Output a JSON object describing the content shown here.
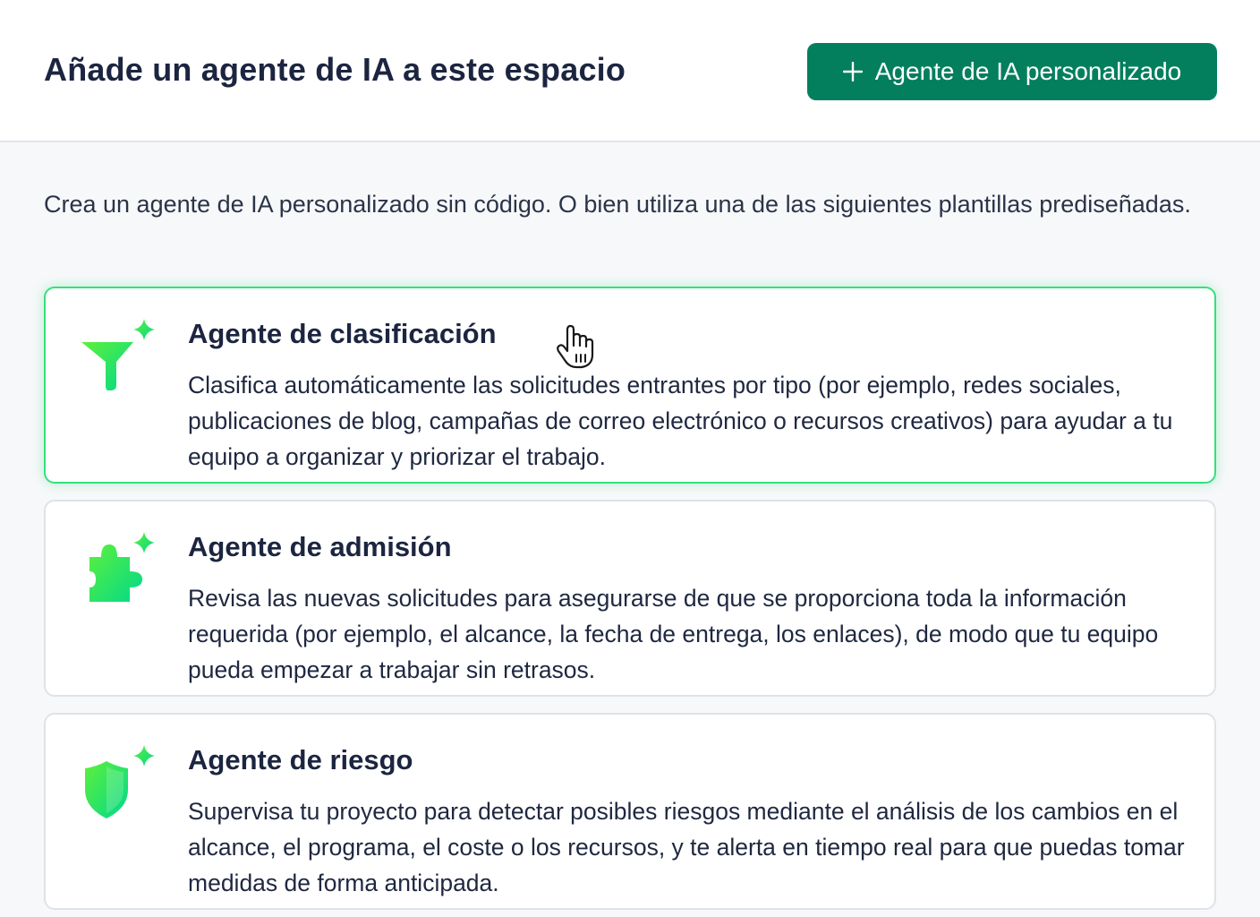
{
  "header": {
    "title": "Añade un agente de IA a este espacio",
    "add_button_label": "Agente de IA personalizado",
    "add_button_icon": "plus-icon"
  },
  "intro_text": "Crea un agente de IA personalizado sin código. O bien utiliza una de las siguientes plantillas prediseñadas.",
  "cards": [
    {
      "title": "Agente de clasificación",
      "description": "Clasifica automáticamente las solicitudes entrantes por tipo (por ejemplo, redes sociales, publicaciones de blog, campañas de correo electrónico o recursos creativos) para ayudar a tu equipo a organizar y priorizar el trabajo.",
      "icon": "funnel-sparkle-icon",
      "hovered": true
    },
    {
      "title": "Agente de admisión",
      "description": "Revisa las nuevas solicitudes para asegurarse de que se proporciona toda la información requerida (por ejemplo, el alcance, la fecha de entrega, los enlaces), de modo que tu equipo pueda empezar a trabajar sin retrasos.",
      "icon": "puzzle-sparkle-icon",
      "hovered": false
    },
    {
      "title": "Agente de riesgo",
      "description": "Supervisa tu proyecto para detectar posibles riesgos mediante el análisis de los cambios en el alcance, el programa, el coste o los recursos, y te alerta en tiempo real para que puedas tomar medidas de forma anticipada.",
      "icon": "shield-sparkle-icon",
      "hovered": false
    }
  ],
  "colors": {
    "primary_button": "#047f5e",
    "active_border": "#35e07c",
    "icon_gradient_start": "#5ef03a",
    "icon_gradient_end": "#00d98b"
  }
}
